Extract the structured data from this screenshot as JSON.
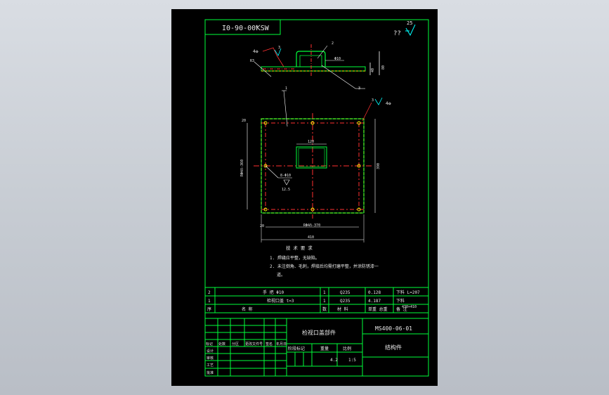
{
  "drawing": {
    "title_code": "I0-90-00ꝀSW",
    "roughness_corner": "??",
    "roughness_value": "25",
    "callout_1": "1",
    "callout_2": "2",
    "callout_3": "3",
    "weld_note_1": "3",
    "weld_note_2": "3",
    "weld_note_3": "3",
    "weld_sym_a": "4ꝋ",
    "weld_sym_b": "4ꝋ",
    "dim_phi": "Φ10",
    "dim_r": "R3",
    "dim_height": "80",
    "dim_top_small": "40",
    "dim_hole_w": "120",
    "dim_left_vert": "RΦ4Λ-360",
    "dim_right_vert": "390",
    "dim_bottom_inner": "RΦ4Λ-370",
    "dim_bottom_outer": "410",
    "dim_side_small": "20",
    "dim_left_top": "20",
    "hole_note": "8-Φ10",
    "hole_rough": "12.5"
  },
  "notes": {
    "heading": "技 术 要 求",
    "line1": "1. 焊缝应平整，无缺陷。",
    "line2": "2. 未注倒角、毛刺，焊接后均需打磨平整，并涂防锈漆一",
    "line3": "道。"
  },
  "bom": {
    "rows": [
      {
        "no": "2",
        "name": "手 把  Φ10",
        "qty": "1",
        "material": "Q235",
        "weight": "0.128",
        "remark": "下料 L=207"
      },
      {
        "no": "1",
        "name": "检视口盖  t=3",
        "qty": "1",
        "material": "Q235",
        "weight": "4.187",
        "remark": "下料"
      }
    ],
    "remark_extra": "430×410",
    "header": {
      "no": "序",
      "name": "名    称",
      "qty": "数",
      "material": "材  料",
      "weight": "单重 总重",
      "remark": "备 注"
    }
  },
  "title_block": {
    "part_name": "检视口盖部件",
    "drawing_no": "MS400-06-01",
    "company": "结构件",
    "scale": "1:5",
    "weight": "4.2",
    "labels_left": [
      "标记",
      "处数",
      "分区",
      "更改文件号",
      "签名",
      "年月日"
    ],
    "roles": [
      "设计",
      "审核",
      "工艺",
      "批准"
    ],
    "stage_labels": [
      "阶段标记",
      "重量",
      "比例"
    ]
  }
}
